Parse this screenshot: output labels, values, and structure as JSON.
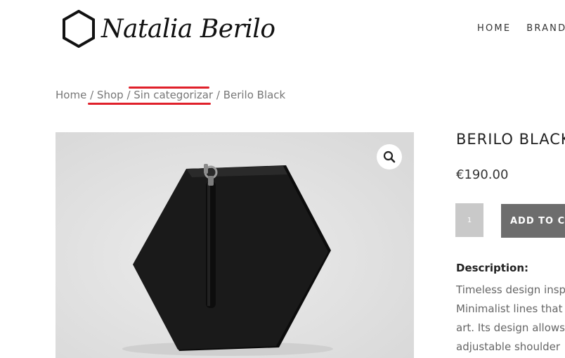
{
  "header": {
    "logo_text": "Natalia Berilo",
    "nav": [
      "HOME",
      "BRAND"
    ]
  },
  "breadcrumb": {
    "items": [
      "Home",
      "Shop",
      "Sin categorizar"
    ],
    "current": "Berilo Black",
    "separator": "/"
  },
  "annotation": {
    "highlight_color": "#e0202a"
  },
  "product": {
    "title": "BERILO BLACK",
    "price": "€190.00",
    "quantity": "1",
    "add_to_cart": "ADD TO CART",
    "description_label": "Description:",
    "description_lines": [
      "Timeless design insp",
      "Minimalist lines that",
      "art. Its design allows",
      "adjustable shoulder"
    ],
    "image_subject": "black hexagonal leather clutch with wrist strap"
  },
  "colors": {
    "button_bg": "#6d6d6d",
    "qty_bg": "#c9c9c9",
    "image_bg": "#e3e3e3"
  }
}
